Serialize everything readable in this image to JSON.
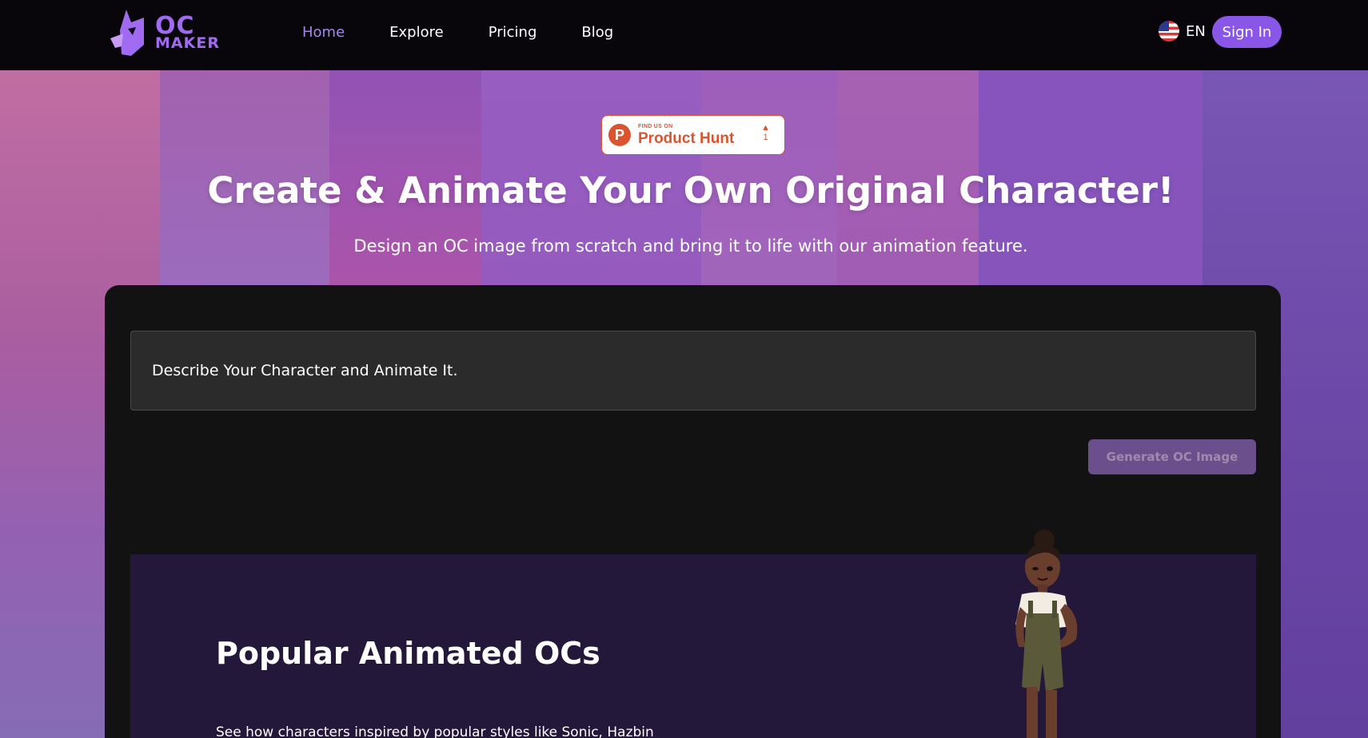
{
  "header": {
    "logo": {
      "line1": "OC",
      "line2": "MAKER"
    },
    "nav": [
      {
        "label": "Home",
        "active": true
      },
      {
        "label": "Explore",
        "active": false
      },
      {
        "label": "Pricing",
        "active": false
      },
      {
        "label": "Blog",
        "active": false
      }
    ],
    "language": "EN",
    "sign_in": "Sign In"
  },
  "hero": {
    "badge": {
      "small": "FIND US ON",
      "big": "Product Hunt",
      "votes": "1"
    },
    "title": "Create & Animate Your Own Original Character!",
    "subtitle": "Design an OC image from scratch and bring it to life with our animation feature."
  },
  "generator": {
    "prompt_value": "Describe Your Character and Animate It.",
    "button": "Generate OC Image"
  },
  "popular": {
    "title": "Popular Animated OCs",
    "description": "See how characters inspired by popular styles like Sonic, Hazbin"
  },
  "colors": {
    "accent": "#8a56e8",
    "nav_active": "#a883f0",
    "product_hunt": "#da552f",
    "card_bg": "#121212",
    "popular_bg": "#23173a"
  }
}
